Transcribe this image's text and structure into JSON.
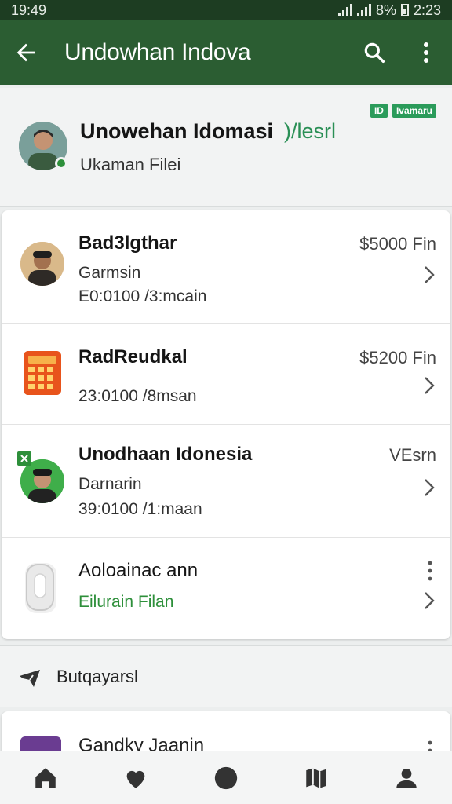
{
  "status_bar": {
    "time_left": "19:49",
    "battery_text": "8%",
    "time_right": "2:23"
  },
  "app_bar": {
    "title": "Undowhan Indova",
    "back_icon": "arrow-left-icon",
    "search_icon": "search-icon",
    "more_icon": "more-vert-icon"
  },
  "profile": {
    "name": "Unowehan Idomasi",
    "name_extra": ")/lesrl",
    "subtitle": "Ukaman Filei",
    "tags": [
      "ID",
      "Ivamaru"
    ]
  },
  "list": {
    "items": [
      {
        "title": "Bad3lgthar",
        "line2": "Garmsin",
        "line3": "E0:0100 /3:mcain",
        "amount": "$5000 Fin",
        "thumb": "person-avatar"
      },
      {
        "title": "RadReudkal",
        "line2": "23:0100 /8msan",
        "amount": "$5200 Fin",
        "thumb": "calculator-icon"
      },
      {
        "title": "Unodhaan Idonesia",
        "line2": "Darnarin",
        "line3": "39:0100 /1:maan",
        "amount": "VEsrn",
        "thumb": "person-avatar"
      },
      {
        "title": "Aoloainac ann",
        "line2": "Eilurain Filan",
        "thumb": "device-icon"
      }
    ]
  },
  "section": {
    "label": "Butqayarsl",
    "icon": "plane-icon"
  },
  "partial_item": {
    "title": "Gandky Jaanin"
  },
  "bottom_nav": [
    "home-icon",
    "heart-icon",
    "moon-icon",
    "map-icon",
    "profile-icon"
  ],
  "colors": {
    "status_bar": "#1d3d22",
    "app_bar": "#2b5d32",
    "accent_green": "#2d8f3a"
  }
}
